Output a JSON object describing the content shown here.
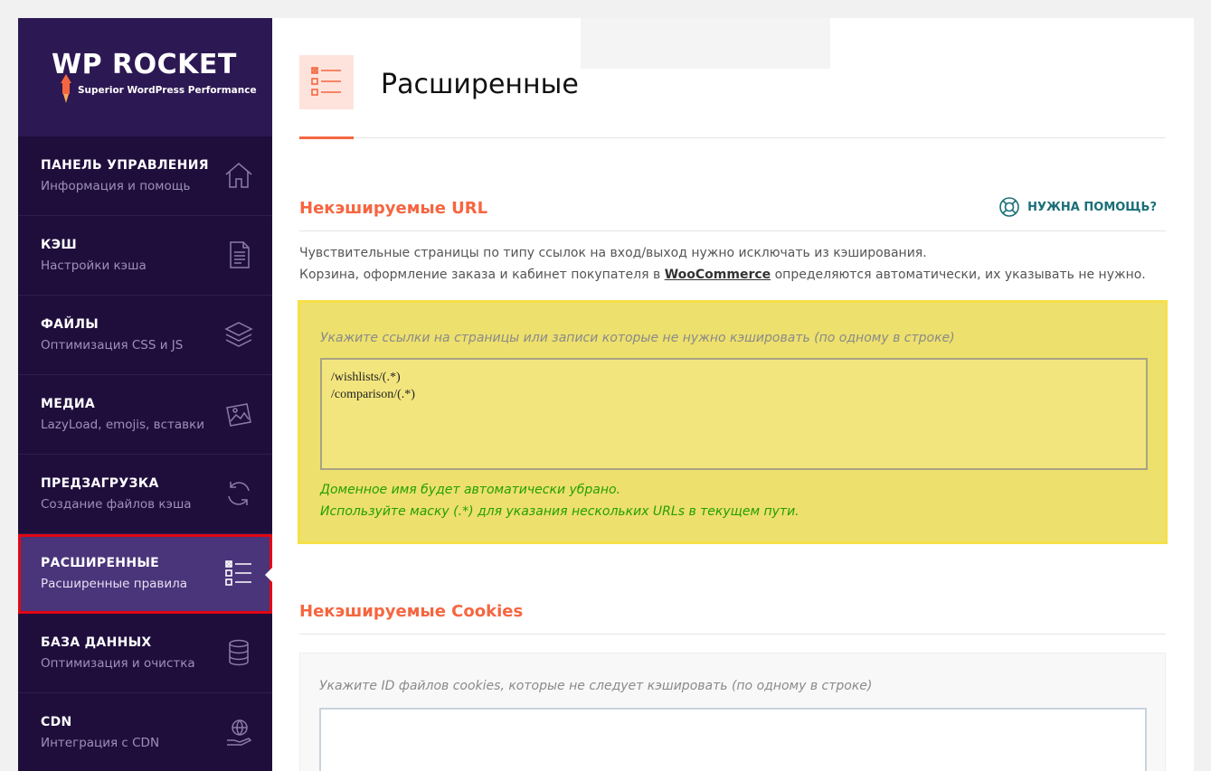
{
  "brand": {
    "title": "WP ROCKET",
    "subtitle": "Superior WordPress Performance"
  },
  "sidebar": {
    "items": [
      {
        "title": "ПАНЕЛЬ УПРАВЛЕНИЯ",
        "subtitle": "Информация и помощь",
        "icon": "home-icon"
      },
      {
        "title": "КЭШ",
        "subtitle": "Настройки кэша",
        "icon": "document-icon"
      },
      {
        "title": "ФАЙЛЫ",
        "subtitle": "Оптимизация CSS и JS",
        "icon": "layers-icon"
      },
      {
        "title": "МЕДИА",
        "subtitle": "LazyLoad, emojis, вставки",
        "icon": "images-icon"
      },
      {
        "title": "ПРЕДЗАГРУЗКА",
        "subtitle": "Создание файлов кэша",
        "icon": "refresh-icon"
      },
      {
        "title": "РАСШИРЕННЫЕ",
        "subtitle": "Расширенные правила",
        "icon": "checklist-icon"
      },
      {
        "title": "БАЗА ДАННЫХ",
        "subtitle": "Оптимизация и очистка",
        "icon": "database-icon"
      },
      {
        "title": "CDN",
        "subtitle": "Интеграция с CDN",
        "icon": "globe-hand-icon"
      }
    ]
  },
  "page": {
    "title": "Расширенные"
  },
  "section1": {
    "title": "Некэшируемые URL",
    "help": "НУЖНА ПОМОЩЬ?",
    "desc_line1": "Чувствительные страницы по типу ссылок на вход/выход нужно исключать из кэширования.",
    "desc_line2_pre": "Корзина, оформление заказа и кабинет покупателя в ",
    "desc_line2_link": "WooCommerce",
    "desc_line2_post": " определяются автоматически, их указывать не нужно.",
    "field_label": "Укажите ссылки на страницы или записи которые не нужно кэшировать (по одному в строке)",
    "field_value": "/wishlists/(.*)\n/comparison/(.*)",
    "hint1": "Доменное имя будет автоматически убрано.",
    "hint2": "Используйте маску (.*) для указания нескольких URLs в текущем пути."
  },
  "section2": {
    "title": "Некэшируемые Cookies",
    "field_label": "Укажите ID файлов cookies, которые не следует кэшировать (по одному в строке)",
    "field_value": ""
  },
  "colors": {
    "accent": "#f56640",
    "sidebar_bg": "#1f0e3c",
    "active_bg": "#4a347a",
    "highlight_yellow": "#ede06d",
    "hint_green": "#24a000",
    "help_teal": "#1a6f77"
  }
}
